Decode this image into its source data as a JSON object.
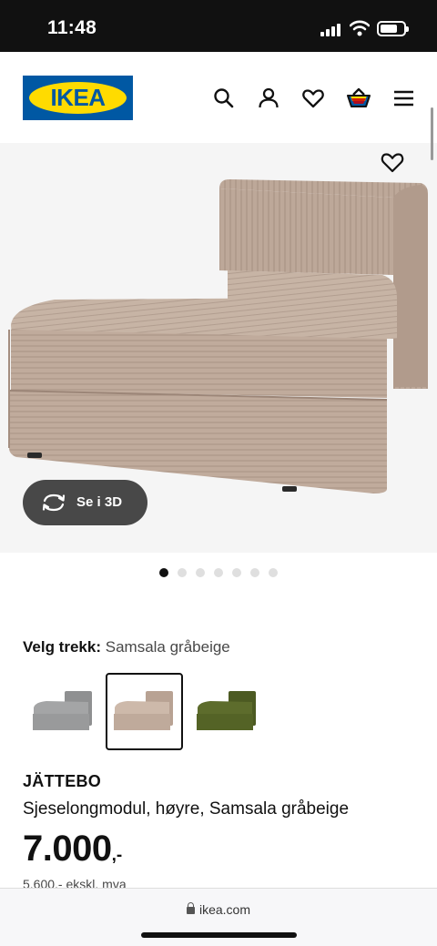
{
  "status": {
    "time": "11:48"
  },
  "header": {
    "logo_text": "IKEA",
    "icons": [
      "search-icon",
      "user-icon",
      "heart-icon",
      "basket-icon",
      "menu-icon"
    ]
  },
  "gallery": {
    "view_3d_label": "Se i 3D",
    "dot_count": 7,
    "active_dot": 1
  },
  "variant": {
    "label": "Velg trekk:",
    "value": "Samsala gråbeige",
    "swatches": [
      "grey",
      "beige",
      "green"
    ],
    "selected": "beige"
  },
  "product": {
    "name": "JÄTTEBO",
    "description": "Sjeselongmodul, høyre, Samsala gråbeige",
    "price": "7.000",
    "price_suffix": ",-",
    "price_ex_vat": "5.600,- ekskl. mva"
  },
  "browser": {
    "url": "ikea.com"
  },
  "colors": {
    "ikea_blue": "#0058a3",
    "ikea_yellow": "#ffdb00",
    "fabric_beige": "#bfaa9b"
  }
}
